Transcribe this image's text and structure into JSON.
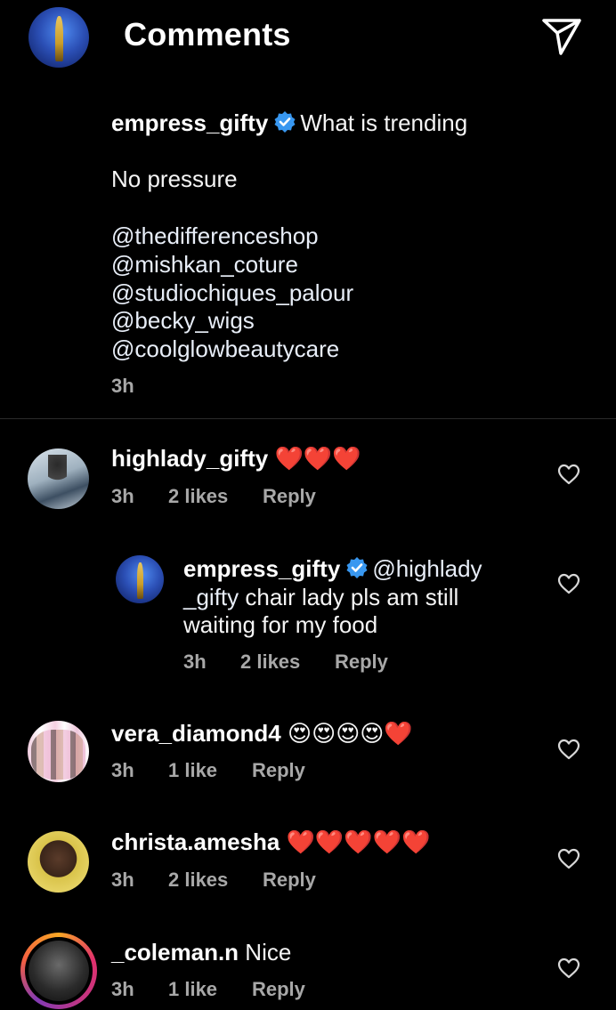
{
  "header": {
    "title": "Comments"
  },
  "caption": {
    "username": "empress_gifty",
    "line1": "What is trending",
    "line2": "No pressure",
    "mentions": [
      "@thedifferenceshop",
      "@mishkan_coture",
      "@studiochiques_palour",
      "@becky_wigs",
      "@coolglowbeautycare"
    ],
    "time": "3h"
  },
  "comments": [
    {
      "username": "highlady_gifty",
      "text": "❤️❤️❤️",
      "time": "3h",
      "likes": "2 likes",
      "reply": "Reply"
    },
    {
      "username": "empress_gifty",
      "mention_line1": "@highlady",
      "mention_line2": "_gifty",
      "text_line2": "chair lady  pls am still",
      "text_line3": "waiting for my food",
      "time": "3h",
      "likes": "2 likes",
      "reply": "Reply"
    },
    {
      "username": "vera_diamond4",
      "text": "😍😍😍😍❤️",
      "time": "3h",
      "likes": "1 like",
      "reply": "Reply"
    },
    {
      "username": "christa.amesha",
      "text": "❤️❤️❤️❤️❤️",
      "time": "3h",
      "likes": "2 likes",
      "reply": "Reply"
    },
    {
      "username": "_coleman.n",
      "text": "Nice",
      "time": "3h",
      "likes": "1 like",
      "reply": "Reply"
    }
  ],
  "icons": {
    "back": "arrow-left-icon",
    "share": "paper-plane-icon",
    "verified": "verified-badge-icon",
    "like": "heart-outline-icon"
  },
  "colors": {
    "background": "#000000",
    "verified": "#3897f0",
    "meta": "#a8a8a8",
    "heart": "#e0242f"
  }
}
